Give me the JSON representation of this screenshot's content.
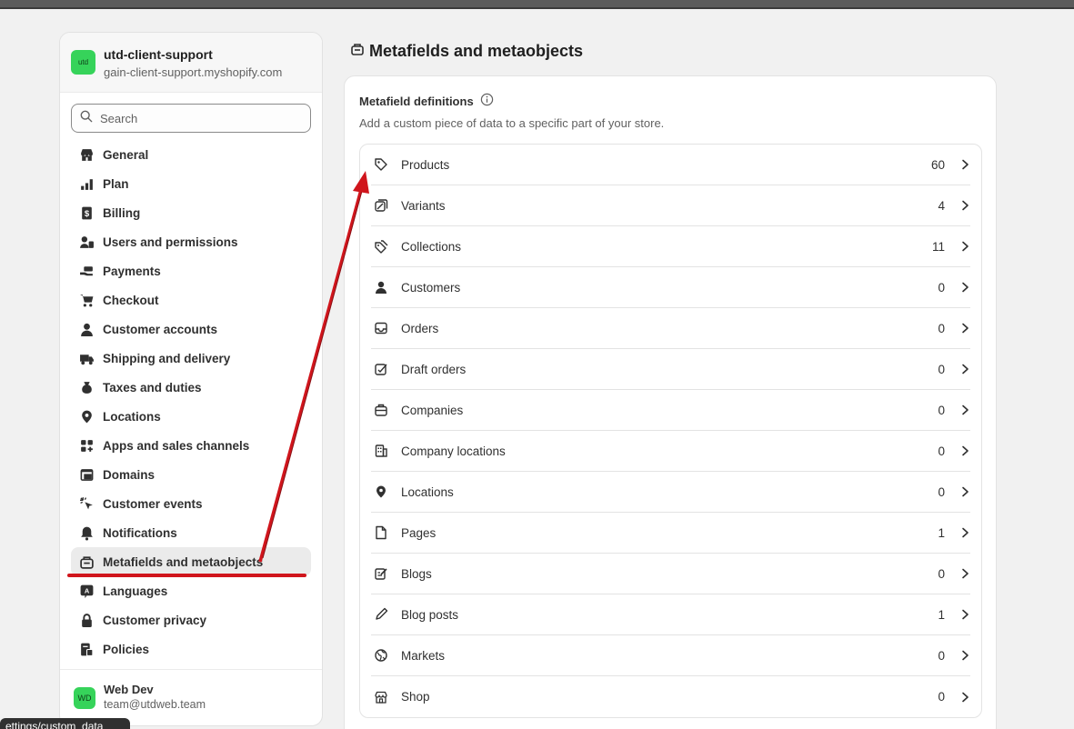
{
  "store": {
    "avatar_text": "utd",
    "name": "utd-client-support",
    "domain": "gain-client-support.myshopify.com"
  },
  "search": {
    "placeholder": "Search"
  },
  "nav": {
    "items": [
      {
        "label": "General",
        "icon": "store-icon"
      },
      {
        "label": "Plan",
        "icon": "plan-chart-icon"
      },
      {
        "label": "Billing",
        "icon": "billing-dollar-icon"
      },
      {
        "label": "Users and permissions",
        "icon": "users-icon"
      },
      {
        "label": "Payments",
        "icon": "payments-hand-icon"
      },
      {
        "label": "Checkout",
        "icon": "cart-icon"
      },
      {
        "label": "Customer accounts",
        "icon": "person-icon"
      },
      {
        "label": "Shipping and delivery",
        "icon": "truck-icon"
      },
      {
        "label": "Taxes and duties",
        "icon": "tax-bag-icon"
      },
      {
        "label": "Locations",
        "icon": "location-pin-icon"
      },
      {
        "label": "Apps and sales channels",
        "icon": "apps-icon"
      },
      {
        "label": "Domains",
        "icon": "domains-globe-icon"
      },
      {
        "label": "Customer events",
        "icon": "cursor-click-icon"
      },
      {
        "label": "Notifications",
        "icon": "bell-icon"
      },
      {
        "label": "Metafields and metaobjects",
        "icon": "metafields-icon"
      },
      {
        "label": "Languages",
        "icon": "language-icon"
      },
      {
        "label": "Customer privacy",
        "icon": "lock-icon"
      },
      {
        "label": "Policies",
        "icon": "policies-icon"
      }
    ],
    "active_index": 14
  },
  "user": {
    "avatar_text": "WD",
    "name": "Web Dev",
    "email": "team@utdweb.team"
  },
  "page": {
    "title": "Metafields and metaobjects"
  },
  "definitions": {
    "title": "Metafield definitions",
    "description": "Add a custom piece of data to a specific part of your store.",
    "rows": [
      {
        "label": "Products",
        "count": "60",
        "icon": "tag-icon"
      },
      {
        "label": "Variants",
        "count": "4",
        "icon": "variants-icon"
      },
      {
        "label": "Collections",
        "count": "11",
        "icon": "collection-tags-icon"
      },
      {
        "label": "Customers",
        "count": "0",
        "icon": "person-icon"
      },
      {
        "label": "Orders",
        "count": "0",
        "icon": "inbox-icon"
      },
      {
        "label": "Draft orders",
        "count": "0",
        "icon": "draft-order-icon"
      },
      {
        "label": "Companies",
        "count": "0",
        "icon": "briefcase-icon"
      },
      {
        "label": "Company locations",
        "count": "0",
        "icon": "building-icon"
      },
      {
        "label": "Locations",
        "count": "0",
        "icon": "location-pin-icon"
      },
      {
        "label": "Pages",
        "count": "1",
        "icon": "page-icon"
      },
      {
        "label": "Blogs",
        "count": "0",
        "icon": "blog-icon"
      },
      {
        "label": "Blog posts",
        "count": "1",
        "icon": "pencil-icon"
      },
      {
        "label": "Markets",
        "count": "0",
        "icon": "globe-icon"
      },
      {
        "label": "Shop",
        "count": "0",
        "icon": "shop-icon"
      }
    ]
  },
  "tooltip": {
    "text": "ettings/custom_data"
  },
  "colors": {
    "annotation": "#d0151c",
    "brand_green": "#36d35a"
  }
}
